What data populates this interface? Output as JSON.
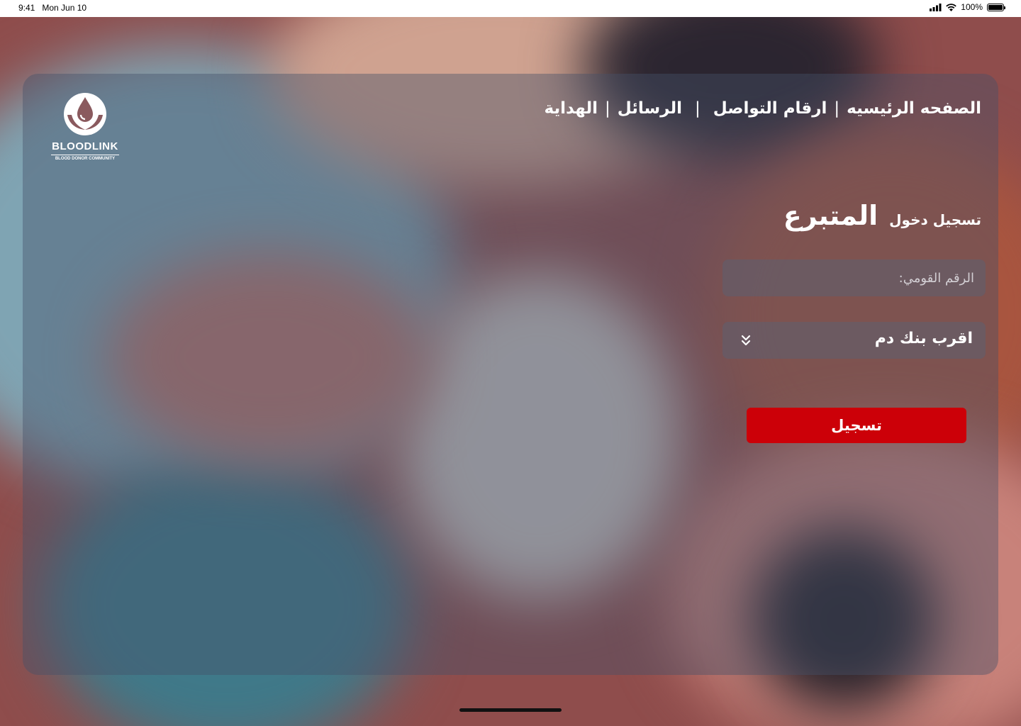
{
  "status_bar": {
    "time": "9:41",
    "date": "Mon Jun 10",
    "battery_percent": "100%"
  },
  "brand": {
    "name": "BLOODLINK",
    "tagline": "BLOOD DONOR COMMUNITY",
    "logo_icon": "blood-drop-hands-icon"
  },
  "nav": {
    "items": [
      {
        "label": "الصفحه الرئيسيه"
      },
      {
        "label": "ارقام التواصل"
      },
      {
        "label": "الرسائل"
      },
      {
        "label": "الهداية"
      }
    ],
    "separator": "|"
  },
  "login": {
    "subtitle": "تسجيل دخول",
    "title": "المتبرع",
    "national_id_placeholder": "الرقم القومي:",
    "nearest_bank_label": "اقرب بنك دم",
    "dropdown_icon": "chevron-double-down-icon",
    "submit_label": "تسجيل"
  },
  "colors": {
    "primary_button": "#cc0008",
    "text": "#ffffff"
  }
}
